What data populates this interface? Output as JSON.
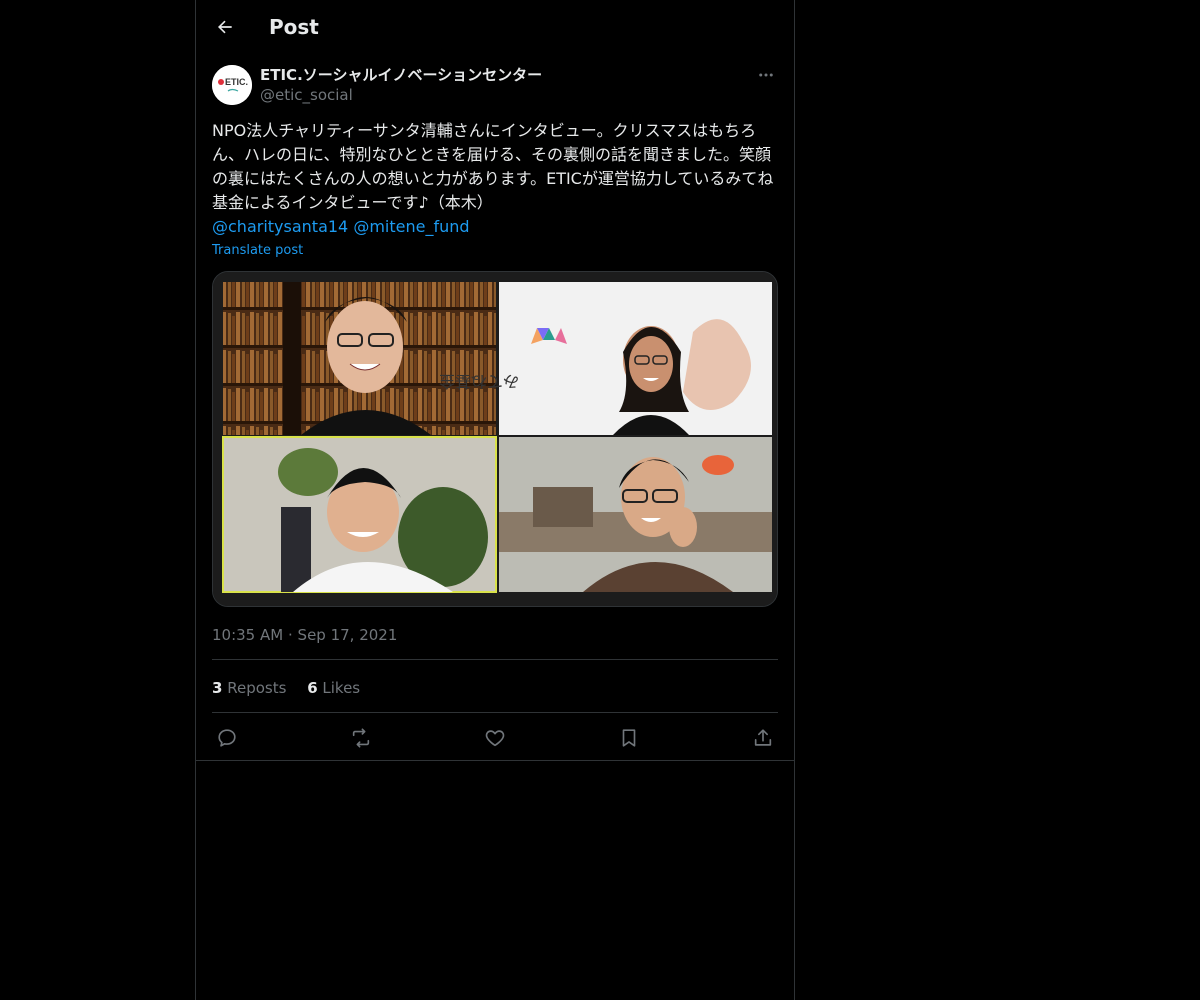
{
  "header": {
    "title": "Post"
  },
  "author": {
    "display_name": "ETIC.ソーシャルイノベーションセンター",
    "handle": "@etic_social",
    "avatar_text": "ETIC."
  },
  "post": {
    "text": "NPO法人チャリティーサンタ清輔さんにインタビュー。クリスマスはもちろん、ハレの日に、特別なひとときを届ける、その裏側の話を聞きました。笑顔の裏にはたくさんの人の想いと力があります。ETICが運営協力しているみてね基金によるインタビューです♪（本木）",
    "mentions": [
      "@charitysanta14",
      "@mitene_fund"
    ],
    "translate_label": "Translate post",
    "media_text": "みてね基金"
  },
  "meta": {
    "time": "10:35 AM",
    "separator": "·",
    "date": "Sep 17, 2021"
  },
  "stats": {
    "reposts_count": "3",
    "reposts_label": "Reposts",
    "likes_count": "6",
    "likes_label": "Likes"
  },
  "icons": {
    "back": "arrow-left-icon",
    "more": "more-horizontal-icon",
    "reply": "reply-icon",
    "repost": "repost-icon",
    "like": "heart-icon",
    "bookmark": "bookmark-icon",
    "share": "share-icon"
  },
  "colors": {
    "background": "#000000",
    "text": "#e7e9ea",
    "muted": "#71767b",
    "link": "#1d9bf0",
    "border": "#2f3336"
  }
}
